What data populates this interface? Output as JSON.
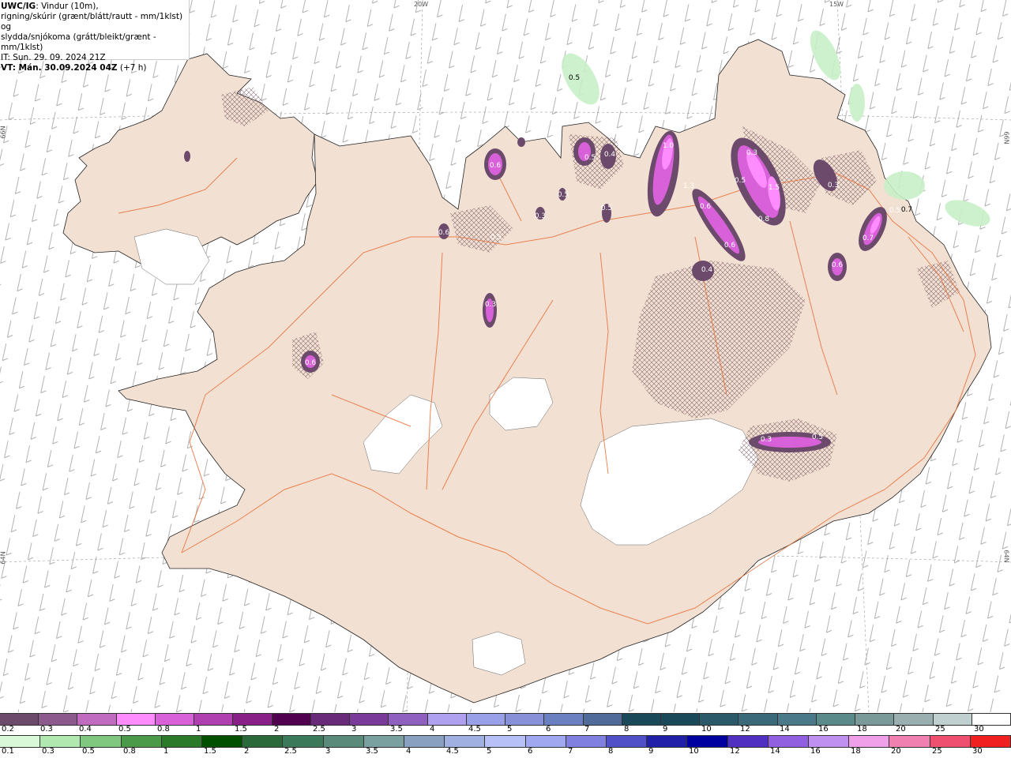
{
  "header": {
    "code": "UWC/IG",
    "line1_rest": ": Vindur (10m),",
    "line2": "rigning/skúrir (grænt/blátt/rautt - mm/1klst) og",
    "line3": "slydda/snjókoma (grátt/bleikt/grænt - mm/1klst)",
    "line4": "IT: Sun. 29. 09. 2024 21Z",
    "vt_label": "VT: Mán. 30.09.2024 04Z",
    "vt_offset": " (+7 h)"
  },
  "grid_labels": {
    "lon_20w": "20W",
    "lon_15w": "15W",
    "lat_66n_left": "66N",
    "lat_66n_right": "66N",
    "lat_64n_left": "64N",
    "lat_64n_right": "64N"
  },
  "precip_values": [
    {
      "id": "v1",
      "text": "0.5"
    },
    {
      "id": "v2",
      "text": "0.6"
    },
    {
      "id": "v3",
      "text": "0.5"
    },
    {
      "id": "v4",
      "text": "0.4"
    },
    {
      "id": "v5",
      "text": "1.0"
    },
    {
      "id": "v6",
      "text": "0.3"
    },
    {
      "id": "v7",
      "text": "0.5"
    },
    {
      "id": "v8",
      "text": "1.5"
    },
    {
      "id": "v9",
      "text": "0.3"
    },
    {
      "id": "v10",
      "text": "1.3"
    },
    {
      "id": "v11",
      "text": "0.6"
    },
    {
      "id": "v12",
      "text": "0.8"
    },
    {
      "id": "v13",
      "text": "0.6"
    },
    {
      "id": "v14",
      "text": "0.4"
    },
    {
      "id": "v15",
      "text": "0.7"
    },
    {
      "id": "v16",
      "text": "0.5"
    },
    {
      "id": "v17",
      "text": "0.6"
    },
    {
      "id": "v18",
      "text": "0.3"
    },
    {
      "id": "v19",
      "text": "0.6"
    },
    {
      "id": "v20",
      "text": "0.3"
    },
    {
      "id": "v21",
      "text": "0.5"
    },
    {
      "id": "v22",
      "text": "0.5"
    },
    {
      "id": "v23",
      "text": "0.5"
    },
    {
      "id": "v24",
      "text": "0.3"
    },
    {
      "id": "v25",
      "text": "0.6"
    },
    {
      "id": "v26",
      "text": "0.5"
    },
    {
      "id": "v27",
      "text": "0.7"
    }
  ],
  "legend_snow": {
    "labels": [
      "0.2",
      "0.3",
      "0.4",
      "0.5",
      "0.8",
      "1",
      "1.5",
      "2",
      "2.5",
      "3",
      "3.5",
      "4",
      "4.5",
      "5",
      "6",
      "7",
      "8",
      "9",
      "10",
      "12",
      "14",
      "16",
      "18",
      "20",
      "25",
      "30"
    ],
    "colors": [
      "#6b4a6b",
      "#8c5a8c",
      "#c06ac0",
      "#ff8cff",
      "#d860d8",
      "#b040b0",
      "#882088",
      "#50004f",
      "#6a2a7a",
      "#7a3a9a",
      "#9060c0",
      "#b0a0f0",
      "#9aa0e8",
      "#8890d8",
      "#6a80c0",
      "#506a9a",
      "#1a4a5a",
      "#1a4a5a",
      "#2a5a6a",
      "#3a6a7a",
      "#4a7a8a",
      "#5a8a8a",
      "#7a9a9a",
      "#9ab0b0",
      "#c0d0d0",
      "#ffffff"
    ]
  },
  "legend_rain": {
    "labels": [
      "0.1",
      "0.3",
      "0.5",
      "0.8",
      "1",
      "1.5",
      "2",
      "2.5",
      "3",
      "3.5",
      "4",
      "4.5",
      "5",
      "6",
      "7",
      "8",
      "9",
      "10",
      "12",
      "14",
      "16",
      "18",
      "20",
      "25",
      "30"
    ],
    "colors": [
      "#d8f8d8",
      "#b0e8b0",
      "#80c880",
      "#4a9a4a",
      "#2a7a2a",
      "#005000",
      "#2a6a3a",
      "#3a7a5a",
      "#5a8a7a",
      "#7aa0a0",
      "#8aa0c0",
      "#a0b0e0",
      "#b8c0f8",
      "#a0a8f0",
      "#8080e0",
      "#5050c8",
      "#2020a8",
      "#0000a0",
      "#5030c0",
      "#9060e0",
      "#c090f0",
      "#f0a0e8",
      "#f080b0",
      "#f05070",
      "#f02020"
    ]
  }
}
